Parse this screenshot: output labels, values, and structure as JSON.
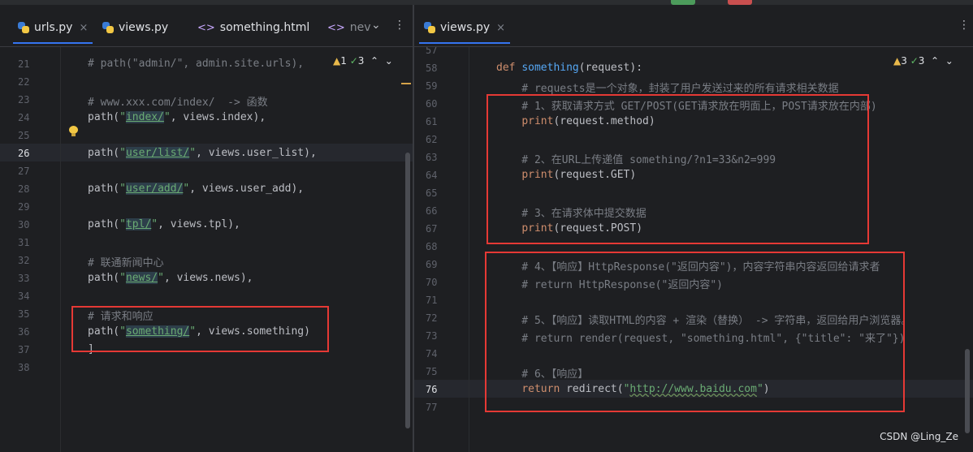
{
  "left_pane": {
    "tabs": [
      {
        "label": "urls.py",
        "icon": "python-file-icon",
        "close": "×"
      },
      {
        "label": "views.py",
        "icon": "python-file-icon"
      },
      {
        "label": "something.html",
        "icon": "html-file-icon",
        "icon_glyph": "<>"
      },
      {
        "label": "nev",
        "icon": "html-file-icon",
        "icon_glyph": "<>"
      }
    ],
    "inspection": {
      "warnings": "1",
      "weak": "3"
    },
    "current_line": "26",
    "lines": [
      {
        "n": "21",
        "tokens": [
          {
            "t": "# path(\"admin/\", admin.site.urls),",
            "c": "cm"
          }
        ]
      },
      {
        "n": "22",
        "tokens": []
      },
      {
        "n": "23",
        "tokens": [
          {
            "t": "# www.xxx.com/index/  -> 函数",
            "c": "cm"
          }
        ]
      },
      {
        "n": "24",
        "tokens": [
          {
            "t": "path(",
            "c": "plain"
          },
          {
            "t": "\"",
            "c": "str"
          },
          {
            "t": "index/",
            "c": "hl"
          },
          {
            "t": "\"",
            "c": "str"
          },
          {
            "t": ", views.index),",
            "c": "plain"
          }
        ]
      },
      {
        "n": "25",
        "tokens": []
      },
      {
        "n": "26",
        "tokens": [
          {
            "t": "path(",
            "c": "plain"
          },
          {
            "t": "\"",
            "c": "str"
          },
          {
            "t": "user/list/",
            "c": "hl"
          },
          {
            "t": "\"",
            "c": "str"
          },
          {
            "t": ", views.user_list),",
            "c": "plain"
          }
        ]
      },
      {
        "n": "27",
        "tokens": []
      },
      {
        "n": "28",
        "tokens": [
          {
            "t": "path(",
            "c": "plain"
          },
          {
            "t": "\"",
            "c": "str"
          },
          {
            "t": "user/add/",
            "c": "hl"
          },
          {
            "t": "\"",
            "c": "str"
          },
          {
            "t": ", views.user_add),",
            "c": "plain"
          }
        ]
      },
      {
        "n": "29",
        "tokens": []
      },
      {
        "n": "30",
        "tokens": [
          {
            "t": "path(",
            "c": "plain"
          },
          {
            "t": "\"",
            "c": "str"
          },
          {
            "t": "tpl/",
            "c": "hl"
          },
          {
            "t": "\"",
            "c": "str"
          },
          {
            "t": ", views.tpl),",
            "c": "plain"
          }
        ]
      },
      {
        "n": "31",
        "tokens": []
      },
      {
        "n": "32",
        "tokens": [
          {
            "t": "# 联通新闻中心",
            "c": "cm"
          }
        ]
      },
      {
        "n": "33",
        "tokens": [
          {
            "t": "path(",
            "c": "plain"
          },
          {
            "t": "\"",
            "c": "str"
          },
          {
            "t": "news/",
            "c": "hl"
          },
          {
            "t": "\"",
            "c": "str"
          },
          {
            "t": ", views.news),",
            "c": "plain"
          }
        ]
      },
      {
        "n": "34",
        "tokens": []
      },
      {
        "n": "35",
        "tokens": [
          {
            "t": "# 请求和响应",
            "c": "cm"
          }
        ]
      },
      {
        "n": "36",
        "tokens": [
          {
            "t": "path(",
            "c": "plain"
          },
          {
            "t": "\"",
            "c": "str"
          },
          {
            "t": "something/",
            "c": "hl"
          },
          {
            "t": "\"",
            "c": "str"
          },
          {
            "t": ", views.something)",
            "c": "plain"
          }
        ]
      },
      {
        "n": "37",
        "tokens": [
          {
            "t": "]",
            "c": "plain"
          }
        ]
      },
      {
        "n": "38",
        "tokens": []
      }
    ]
  },
  "right_pane": {
    "tabs": [
      {
        "label": "views.py",
        "icon": "python-file-icon",
        "close": "×"
      }
    ],
    "inspection": {
      "warnings": "3",
      "weak": "3"
    },
    "current_line": "76",
    "top_partial_line": "57",
    "lines": [
      {
        "n": "58",
        "tokens": [
          {
            "t": "def ",
            "c": "kw"
          },
          {
            "t": "something",
            "c": "fn"
          },
          {
            "t": "(request):",
            "c": "plain"
          }
        ]
      },
      {
        "n": "59",
        "tokens": [
          {
            "t": "    # requests是一个对象，封装了用户发送过来的所有请求相关数据",
            "c": "cm"
          }
        ]
      },
      {
        "n": "60",
        "tokens": [
          {
            "t": "    # 1、获取请求方式 GET/POST(GET请求放在明面上，POST请求放在内部)",
            "c": "cm"
          }
        ]
      },
      {
        "n": "61",
        "tokens": [
          {
            "t": "    ",
            "c": "plain"
          },
          {
            "t": "print",
            "c": "kw"
          },
          {
            "t": "(request.method)",
            "c": "plain"
          }
        ]
      },
      {
        "n": "62",
        "tokens": []
      },
      {
        "n": "63",
        "tokens": [
          {
            "t": "    # 2、在URL上传递值 something/?n1=33&n2=999",
            "c": "cm"
          }
        ]
      },
      {
        "n": "64",
        "tokens": [
          {
            "t": "    ",
            "c": "plain"
          },
          {
            "t": "print",
            "c": "kw"
          },
          {
            "t": "(request.GET)",
            "c": "plain"
          }
        ]
      },
      {
        "n": "65",
        "tokens": []
      },
      {
        "n": "66",
        "tokens": [
          {
            "t": "    # 3、在请求体中提交数据",
            "c": "cm"
          }
        ]
      },
      {
        "n": "67",
        "tokens": [
          {
            "t": "    ",
            "c": "plain"
          },
          {
            "t": "print",
            "c": "kw"
          },
          {
            "t": "(request.POST)",
            "c": "plain"
          }
        ]
      },
      {
        "n": "68",
        "tokens": []
      },
      {
        "n": "69",
        "tokens": [
          {
            "t": "    # 4、【响应】HttpResponse(\"返回内容\")，内容字符串内容返回给请求者",
            "c": "cm"
          }
        ]
      },
      {
        "n": "70",
        "tokens": [
          {
            "t": "    # return HttpResponse(\"返回内容\")",
            "c": "cm"
          }
        ]
      },
      {
        "n": "71",
        "tokens": []
      },
      {
        "n": "72",
        "tokens": [
          {
            "t": "    # 5、【响应】读取HTML的内容 + 渲染（替换） -> 字符串，返回给用户浏览器。",
            "c": "cm"
          }
        ]
      },
      {
        "n": "73",
        "tokens": [
          {
            "t": "    # return render(request, \"something.html\", {\"title\": \"来了\"})",
            "c": "cm"
          }
        ]
      },
      {
        "n": "74",
        "tokens": []
      },
      {
        "n": "75",
        "tokens": [
          {
            "t": "    # 6、【响应】",
            "c": "cm"
          }
        ]
      },
      {
        "n": "76",
        "tokens": [
          {
            "t": "    ",
            "c": "plain"
          },
          {
            "t": "return ",
            "c": "kw"
          },
          {
            "t": "redirect(",
            "c": "plain"
          },
          {
            "t": "\"",
            "c": "str"
          },
          {
            "t": "http://www.baidu.com",
            "c": "str wavy"
          },
          {
            "t": "\"",
            "c": "str"
          },
          {
            "t": ")",
            "c": "plain"
          }
        ]
      },
      {
        "n": "77",
        "tokens": []
      }
    ]
  },
  "watermark": "CSDN @Ling_Ze",
  "colors": {
    "annotation_box": "#e53935",
    "background": "#1e1f22"
  }
}
